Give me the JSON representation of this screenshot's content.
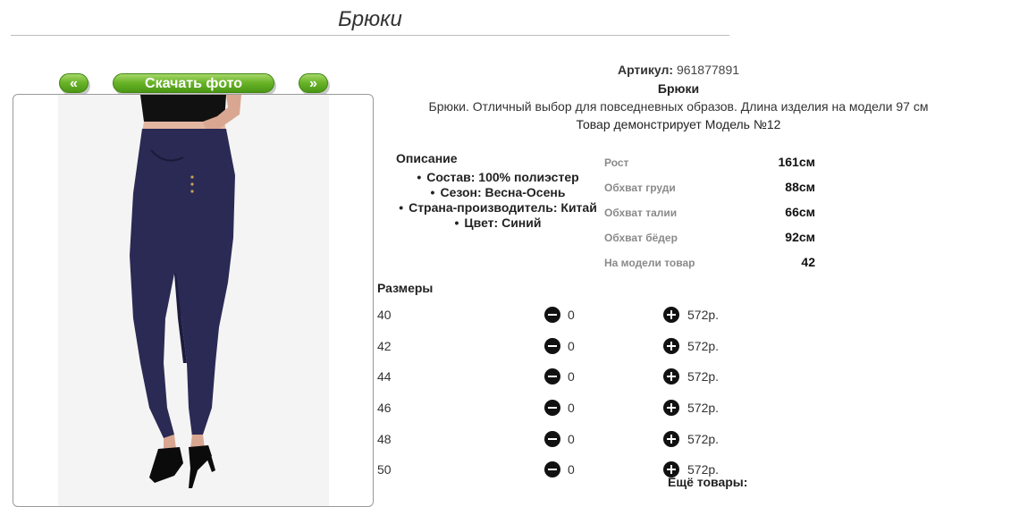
{
  "page": {
    "title": "Брюки"
  },
  "gallery": {
    "prev_label": "«",
    "download_label": "Скачать фото",
    "next_label": "»"
  },
  "product": {
    "article_label": "Артикул:",
    "article_value": "961877891",
    "name": "Брюки",
    "description": "Брюки. Отличный выбор для повседневных образов. Длина изделия на модели 97 см",
    "model_note": "Товар демонстрирует Модель №12"
  },
  "description": {
    "title": "Описание",
    "items": [
      "Состав: 100% полиэстер",
      "Сезон: Весна-Осень",
      "Страна-производитель: Китай",
      "Цвет: Синий"
    ]
  },
  "model_params": [
    {
      "label": "Рост",
      "value": "161см"
    },
    {
      "label": "Обхват груди",
      "value": "88см"
    },
    {
      "label": "Обхват талии",
      "value": "66см"
    },
    {
      "label": "Обхват бёдер",
      "value": "92см"
    },
    {
      "label": "На модели товар",
      "value": "42"
    }
  ],
  "sizes": {
    "title": "Размеры",
    "rows": [
      {
        "size": "40",
        "qty": "0",
        "price": "572р."
      },
      {
        "size": "42",
        "qty": "0",
        "price": "572р."
      },
      {
        "size": "44",
        "qty": "0",
        "price": "572р."
      },
      {
        "size": "46",
        "qty": "0",
        "price": "572р."
      },
      {
        "size": "48",
        "qty": "0",
        "price": "572р."
      },
      {
        "size": "50",
        "qty": "0",
        "price": "572р."
      }
    ]
  },
  "more_goods_label": "Ещё товары:",
  "colors": {
    "pants": "#2b2a55",
    "button_green": "#6cb52a"
  }
}
